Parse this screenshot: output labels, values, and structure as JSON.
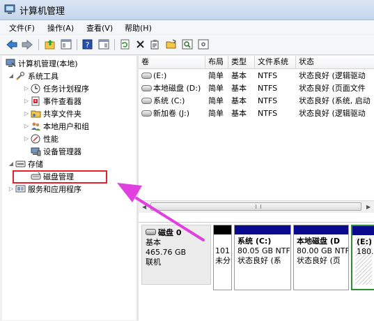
{
  "window": {
    "title": "计算机管理"
  },
  "menu": [
    {
      "label": "文件(F)"
    },
    {
      "label": "操作(A)"
    },
    {
      "label": "查看(V)"
    },
    {
      "label": "帮助(H)"
    }
  ],
  "toolbar_icons": [
    "back-icon",
    "forward-icon",
    "up-folder-icon",
    "show-hide-tree-icon",
    "help-icon",
    "action-pane-icon",
    "refresh-icon",
    "delete-icon",
    "properties-icon",
    "open-icon",
    "search-icon",
    "settings-icon"
  ],
  "tree": {
    "root": "计算机管理(本地)",
    "system_tools": "系统工具",
    "task_scheduler": "任务计划程序",
    "event_viewer": "事件查看器",
    "shared_folders": "共享文件夹",
    "local_users": "本地用户和组",
    "performance": "性能",
    "device_manager": "设备管理器",
    "storage": "存储",
    "disk_management": "磁盘管理",
    "services_apps": "服务和应用程序"
  },
  "volumes": {
    "columns": [
      "卷",
      "布局",
      "类型",
      "文件系统",
      "状态"
    ],
    "rows": [
      {
        "name": "(E:)",
        "layout": "简单",
        "type": "基本",
        "fs": "NTFS",
        "status": "状态良好 (逻辑驱动"
      },
      {
        "name": "本地磁盘 (D:)",
        "layout": "简单",
        "type": "基本",
        "fs": "NTFS",
        "status": "状态良好 (页面文件"
      },
      {
        "name": "系统 (C:)",
        "layout": "简单",
        "type": "基本",
        "fs": "NTFS",
        "status": "状态良好 (系统, 启动"
      },
      {
        "name": "新加卷 (J:)",
        "layout": "简单",
        "type": "基本",
        "fs": "NTFS",
        "status": "状态良好 (逻辑驱动"
      }
    ]
  },
  "disk": {
    "name": "磁盘 0",
    "type": "基本",
    "size": "465.76 GB",
    "state": "联机",
    "partitions": [
      {
        "line1": "",
        "line2": "101",
        "line3": "未分"
      },
      {
        "line1": "系统 (C:)",
        "line2": "80.05 GB NTF",
        "line3": "状态良好 (系"
      },
      {
        "line1": "本地磁盘 (D",
        "line2": "80.00 GB NTF",
        "line3": "状态良好 (页"
      },
      {
        "line1": "(E:)",
        "line2": "180.",
        "line3": ""
      }
    ]
  },
  "colors": {
    "highlight": "#e8202a",
    "arrow": "#e040e0",
    "partition_bar": "#0a0a8e",
    "selected_partition": "#2e8b2e"
  }
}
